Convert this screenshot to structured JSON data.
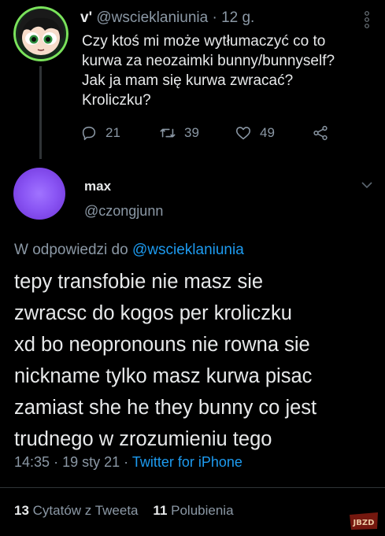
{
  "original_tweet": {
    "display_name": "v'",
    "handle": "@wscieklaniunia",
    "time": "12 g.",
    "lines": [
      "Czy ktoś mi może wytłumaczyć co to",
      "kurwa za neozaimki bunny/bunnyself?",
      "Jak ja mam się kurwa zwracać?",
      "Kroliczku?"
    ],
    "replies": "21",
    "retweets": "39",
    "likes": "49",
    "icons": [
      "reply-icon",
      "retweet-icon",
      "heart-icon",
      "share-icon"
    ]
  },
  "reply": {
    "display_name": "max",
    "handle": "@czongjunn",
    "replying_prefix": "W odpowiedzi do",
    "replying_mention": "@wscieklaniunia",
    "lines": [
      "tepy transfobie nie masz sie",
      "zwracsc do kogos per kroliczku",
      "xd bo neopronouns nie rowna sie",
      "nickname tylko masz kurwa pisac",
      "zamiast she he they bunny co jest",
      "trudnego w zrozumieniu tego"
    ],
    "time": "14:35",
    "date": "19 sty 21",
    "client": "Twitter for iPhone",
    "quote_count": "13",
    "quote_label": "Cytatów z Tweeta",
    "like_count": "11",
    "like_label": "Polubienia"
  },
  "watermark": {
    "text": "JBZD"
  },
  "colors": {
    "background": "#000000",
    "text": "#e7e9ea",
    "muted": "#8b98a5",
    "link": "#1d9bf0",
    "divider": "#2f3336"
  }
}
